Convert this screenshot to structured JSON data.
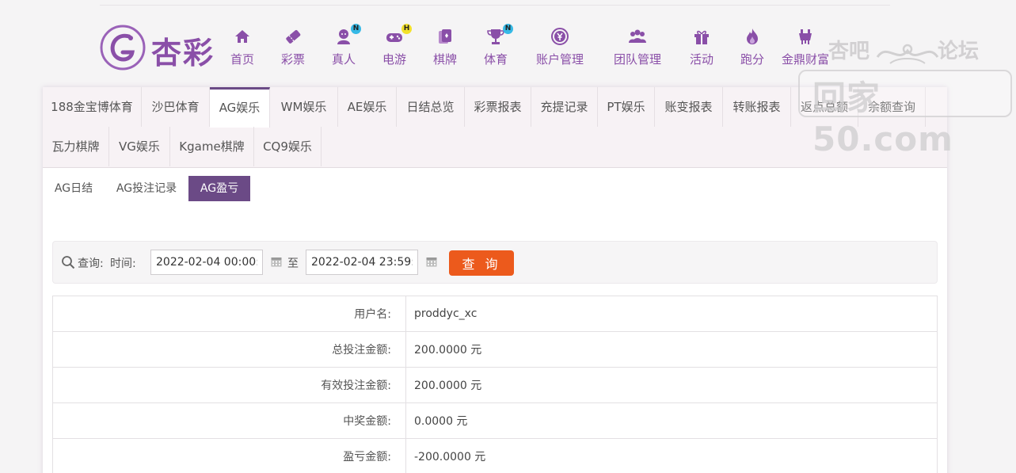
{
  "brand": {
    "name": "杏彩",
    "color": "#8a4fa8"
  },
  "nav": [
    {
      "label": "首页",
      "icon": "home-icon",
      "badge": ""
    },
    {
      "label": "彩票",
      "icon": "lottery-ticket-icon",
      "badge": ""
    },
    {
      "label": "真人",
      "icon": "live-dealer-icon",
      "badge": "N"
    },
    {
      "label": "电游",
      "icon": "gamepad-icon",
      "badge": "H"
    },
    {
      "label": "棋牌",
      "icon": "cards-icon",
      "badge": ""
    },
    {
      "label": "体育",
      "icon": "trophy-icon",
      "badge": "N"
    },
    {
      "label": "账户管理",
      "icon": "yen-coin-icon",
      "badge": ""
    },
    {
      "label": "团队管理",
      "icon": "team-icon",
      "badge": ""
    },
    {
      "label": "活动",
      "icon": "gift-icon",
      "badge": ""
    },
    {
      "label": "跑分",
      "icon": "flame-icon",
      "badge": ""
    },
    {
      "label": "金鼎财富",
      "icon": "ding-cauldron-icon",
      "badge": ""
    }
  ],
  "watermark": {
    "line1_left": "杏吧",
    "line1_right": "论坛",
    "line2": "回家50.com"
  },
  "tabs": [
    {
      "label": "188金宝博体育",
      "active": false
    },
    {
      "label": "沙巴体育",
      "active": false
    },
    {
      "label": "AG娱乐",
      "active": true
    },
    {
      "label": "WM娱乐",
      "active": false
    },
    {
      "label": "AE娱乐",
      "active": false
    },
    {
      "label": "日结总览",
      "active": false
    },
    {
      "label": "彩票报表",
      "active": false
    },
    {
      "label": "充提记录",
      "active": false
    },
    {
      "label": "PT娱乐",
      "active": false
    },
    {
      "label": "账变报表",
      "active": false
    },
    {
      "label": "转账报表",
      "active": false
    },
    {
      "label": "返点总额",
      "active": false
    },
    {
      "label": "余额查询",
      "active": false
    },
    {
      "label": "瓦力棋牌",
      "active": false
    },
    {
      "label": "VG娱乐",
      "active": false
    },
    {
      "label": "Kgame棋牌",
      "active": false
    },
    {
      "label": "CQ9娱乐",
      "active": false
    }
  ],
  "subtabs": [
    {
      "label": "AG日结",
      "active": false
    },
    {
      "label": "AG投注记录",
      "active": false
    },
    {
      "label": "AG盈亏",
      "active": true
    }
  ],
  "query": {
    "label": "查询:",
    "time_label": "时间:",
    "start": "2022-02-04 00:00:00",
    "to": "至",
    "end": "2022-02-04 23:59:59",
    "button": "查 询",
    "button_color": "#ec5a1c"
  },
  "result": [
    {
      "key": "用户名:",
      "value": "proddyc_xc"
    },
    {
      "key": "总投注金额:",
      "value": "200.0000 元"
    },
    {
      "key": "有效投注金额:",
      "value": "200.0000 元"
    },
    {
      "key": "中奖金额:",
      "value": "0.0000 元"
    },
    {
      "key": "盈亏金额:",
      "value": "-200.0000 元"
    }
  ]
}
